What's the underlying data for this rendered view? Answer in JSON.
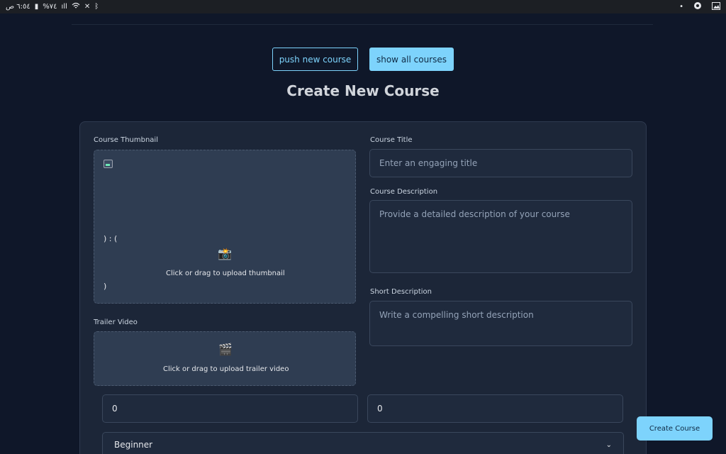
{
  "statusbar": {
    "time": "٦:٥٤ ص",
    "battery": "%٧٤",
    "signal_icon": "signal-icon",
    "wifi_icon": "wifi-icon",
    "mute_icon": "mute-icon",
    "bluetooth_icon": "bluetooth-icon",
    "right_dot": "•"
  },
  "nav": {
    "push_label": "push new course",
    "show_label": "show all courses"
  },
  "page": {
    "title": "Create New Course"
  },
  "form": {
    "thumbnail": {
      "label": "Course Thumbnail",
      "code_line1": ") : (",
      "code_line2": ")",
      "icon": "📸",
      "hint": "Click or drag to upload thumbnail"
    },
    "trailer": {
      "label": "Trailer Video",
      "icon": "🎬",
      "hint": "Click or drag to upload trailer video"
    },
    "title": {
      "label": "Course Title",
      "placeholder": "Enter an engaging title"
    },
    "description": {
      "label": "Course Description",
      "placeholder": "Provide a detailed description of your course"
    },
    "short_description": {
      "label": "Short Description",
      "placeholder": "Write a compelling short description"
    },
    "number1": {
      "value": "0"
    },
    "number2": {
      "value": "0"
    },
    "level": {
      "selected": "Beginner",
      "chevron": "⌄"
    }
  },
  "actions": {
    "create_label": "Create Course"
  },
  "colors": {
    "accent": "#7dd3fc",
    "background": "#0f1729",
    "card": "#1c2638"
  }
}
